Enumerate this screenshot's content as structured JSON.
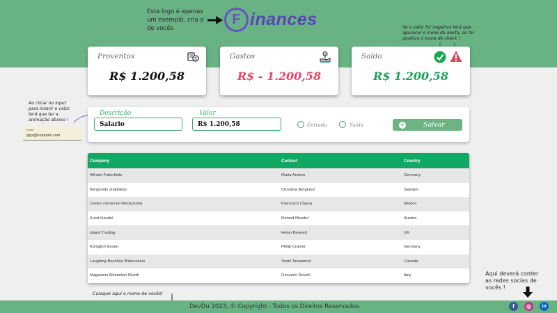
{
  "annotations": {
    "logo_note": "Esta logo é apenas um exemplo, cria a de vocês",
    "saldo_note": "Se o valor for negativo terá que aparecer o ícone de alerta, se for positivo o ícone de check !",
    "input_note": "Ao clicar no input para inserir o valor, terá que ter a animação abaixo !",
    "input_example": {
      "label": "Email",
      "value": "gigs@example.com"
    },
    "name_note": "Coloque aqui o nome de vocês!",
    "social_note": "Aqui deverá conter as redes socias de vocês !"
  },
  "logo": {
    "letter": "F",
    "text": "inances"
  },
  "cards": [
    {
      "title": "Proventos",
      "value": "R$ 1.200,58",
      "color": "#111111",
      "icon": "money-hand-icon"
    },
    {
      "title": "Gastos",
      "value": "R$ - 1.200,58",
      "color": "#e8446b",
      "icon": "spending-hand-icon"
    },
    {
      "title": "Saldo",
      "value": "R$ 1.200,58",
      "color": "#1aa25a",
      "icons": [
        "check-icon",
        "alert-icon"
      ]
    }
  ],
  "form": {
    "description_label": "Descrição",
    "description_value": "Salario",
    "value_label": "Valor",
    "value_value": "R$ 1.200,58",
    "radio_in": "Entrada",
    "radio_out": "Saída",
    "save_label": "Salvar"
  },
  "table": {
    "headers": [
      "Company",
      "Contact",
      "Country"
    ],
    "rows": [
      [
        "Alfreds Futterkiste",
        "Maria Anders",
        "Germany"
      ],
      [
        "Berglunds snabbköp",
        "Christina Berglund",
        "Sweden"
      ],
      [
        "Centro comercial Moctezuma",
        "Francisco Chang",
        "Mexico"
      ],
      [
        "Ernst Handel",
        "Roland Mendel",
        "Austria"
      ],
      [
        "Island Trading",
        "Helen Bennett",
        "UK"
      ],
      [
        "Königlich Essen",
        "Philip Cramer",
        "Germany"
      ],
      [
        "Laughing Bacchus Winecellars",
        "Yoshi Tannamuri",
        "Canada"
      ],
      [
        "Magazzini Alimentari Riuniti",
        "Giovanni Rovelli",
        "Italy"
      ]
    ]
  },
  "footer": {
    "text": "DevDu 2023, © Copyright - Todos os Direitos Reservados."
  },
  "social": [
    {
      "name": "facebook-icon",
      "glyph": "f",
      "color": "#3b5998"
    },
    {
      "name": "instagram-icon",
      "glyph": "◎",
      "color": "#c13584"
    },
    {
      "name": "linkedin-icon",
      "glyph": "in",
      "color": "#0a66c2"
    }
  ],
  "colors": {
    "accent": "#68b284",
    "table_header": "#11a863",
    "input_border": "#3ea86a"
  }
}
